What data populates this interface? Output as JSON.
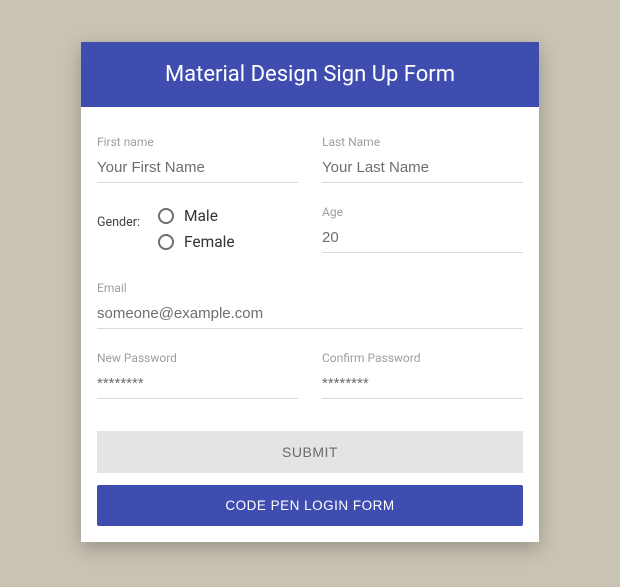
{
  "header": {
    "title": "Material Design Sign Up Form"
  },
  "fields": {
    "firstName": {
      "label": "First name",
      "placeholder": "Your First Name",
      "value": ""
    },
    "lastName": {
      "label": "Last Name",
      "placeholder": "Your Last Name",
      "value": ""
    },
    "gender": {
      "label": "Gender:",
      "options": {
        "male": "Male",
        "female": "Female"
      }
    },
    "age": {
      "label": "Age",
      "value": "20"
    },
    "email": {
      "label": "Email",
      "placeholder": "someone@example.com",
      "value": ""
    },
    "newPassword": {
      "label": "New Password",
      "value": "********"
    },
    "confirmPassword": {
      "label": "Confirm Password",
      "value": "********"
    }
  },
  "buttons": {
    "submit": "SUBMIT",
    "link": "CODE PEN LOGIN FORM"
  }
}
